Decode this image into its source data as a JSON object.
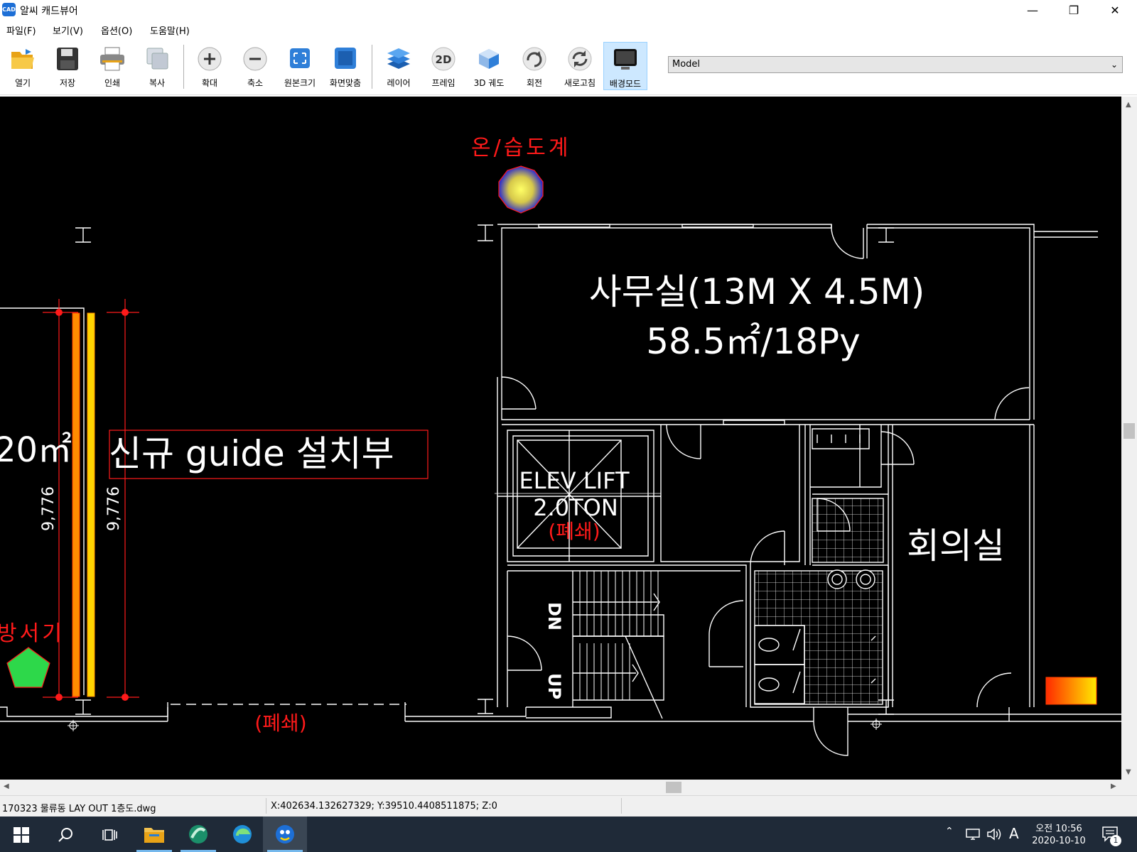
{
  "window": {
    "app_icon_text": "CAD",
    "title": "알씨 캐드뷰어",
    "minimize": "—",
    "maximize": "❐",
    "close": "✕"
  },
  "menu": [
    "파일(F)",
    "보기(V)",
    "옵션(O)",
    "도움말(H)"
  ],
  "toolbar": {
    "buttons": [
      {
        "label": "열기",
        "icon": "folder-open-icon"
      },
      {
        "label": "저장",
        "icon": "floppy-disk-icon"
      },
      {
        "label": "인쇄",
        "icon": "printer-icon"
      },
      {
        "label": "복사",
        "icon": "copy-icon"
      },
      {
        "label": "확대",
        "icon": "zoom-in-icon"
      },
      {
        "label": "축소",
        "icon": "zoom-out-icon"
      },
      {
        "label": "원본크기",
        "icon": "actual-size-icon"
      },
      {
        "label": "화면맞춤",
        "icon": "fit-screen-icon"
      },
      {
        "label": "레이어",
        "icon": "layers-icon"
      },
      {
        "label": "프레임",
        "icon": "frame-2d-icon",
        "icon_text": "2D"
      },
      {
        "label": "3D 궤도",
        "icon": "orbit-3d-icon"
      },
      {
        "label": "회전",
        "icon": "rotate-icon"
      },
      {
        "label": "새로고침",
        "icon": "refresh-icon"
      },
      {
        "label": "배경모드",
        "icon": "background-mode-icon",
        "active": true
      }
    ],
    "model_select": {
      "value": "Model"
    }
  },
  "drawing": {
    "labels": {
      "thermo_hygrometer": "온/습도계",
      "office_line1": "사무실(13M X 4.5M)",
      "office_line2": "58.5㎡/18Py",
      "area_partial": "20㎡",
      "guide_install": "신규 guide 설치부",
      "dim_left": "9,776",
      "dim_right": "9,776",
      "elev_line1": "ELEV LIFT",
      "elev_line2": "2.0TON",
      "closed_elev": "(폐쇄)",
      "closed_bottom": "(폐쇄)",
      "meeting_room": "회의실",
      "dn": "DN",
      "up": "UP",
      "fire_partial": "방서기"
    },
    "colors": {
      "background": "#000000",
      "lines": "#ffffff",
      "red_text": "#ff1a1a",
      "orange_bar": "#ff8c00",
      "yellow_bar": "#ffd400"
    }
  },
  "statusbar": {
    "file": "170323 물류동 LAY OUT 1층도.dwg",
    "coords": "X:402634.132627329; Y:39510.4408511875; Z:0"
  },
  "taskbar": {
    "apps": [
      "start-icon",
      "search-icon",
      "task-view-icon",
      "file-explorer-icon",
      "app-swirl-icon",
      "edge-icon",
      "alsee-cad-icon"
    ],
    "tray_ime": "A",
    "time_line1": "오전 10:56",
    "time_line2": "2020-10-10",
    "notification_count": "1"
  }
}
